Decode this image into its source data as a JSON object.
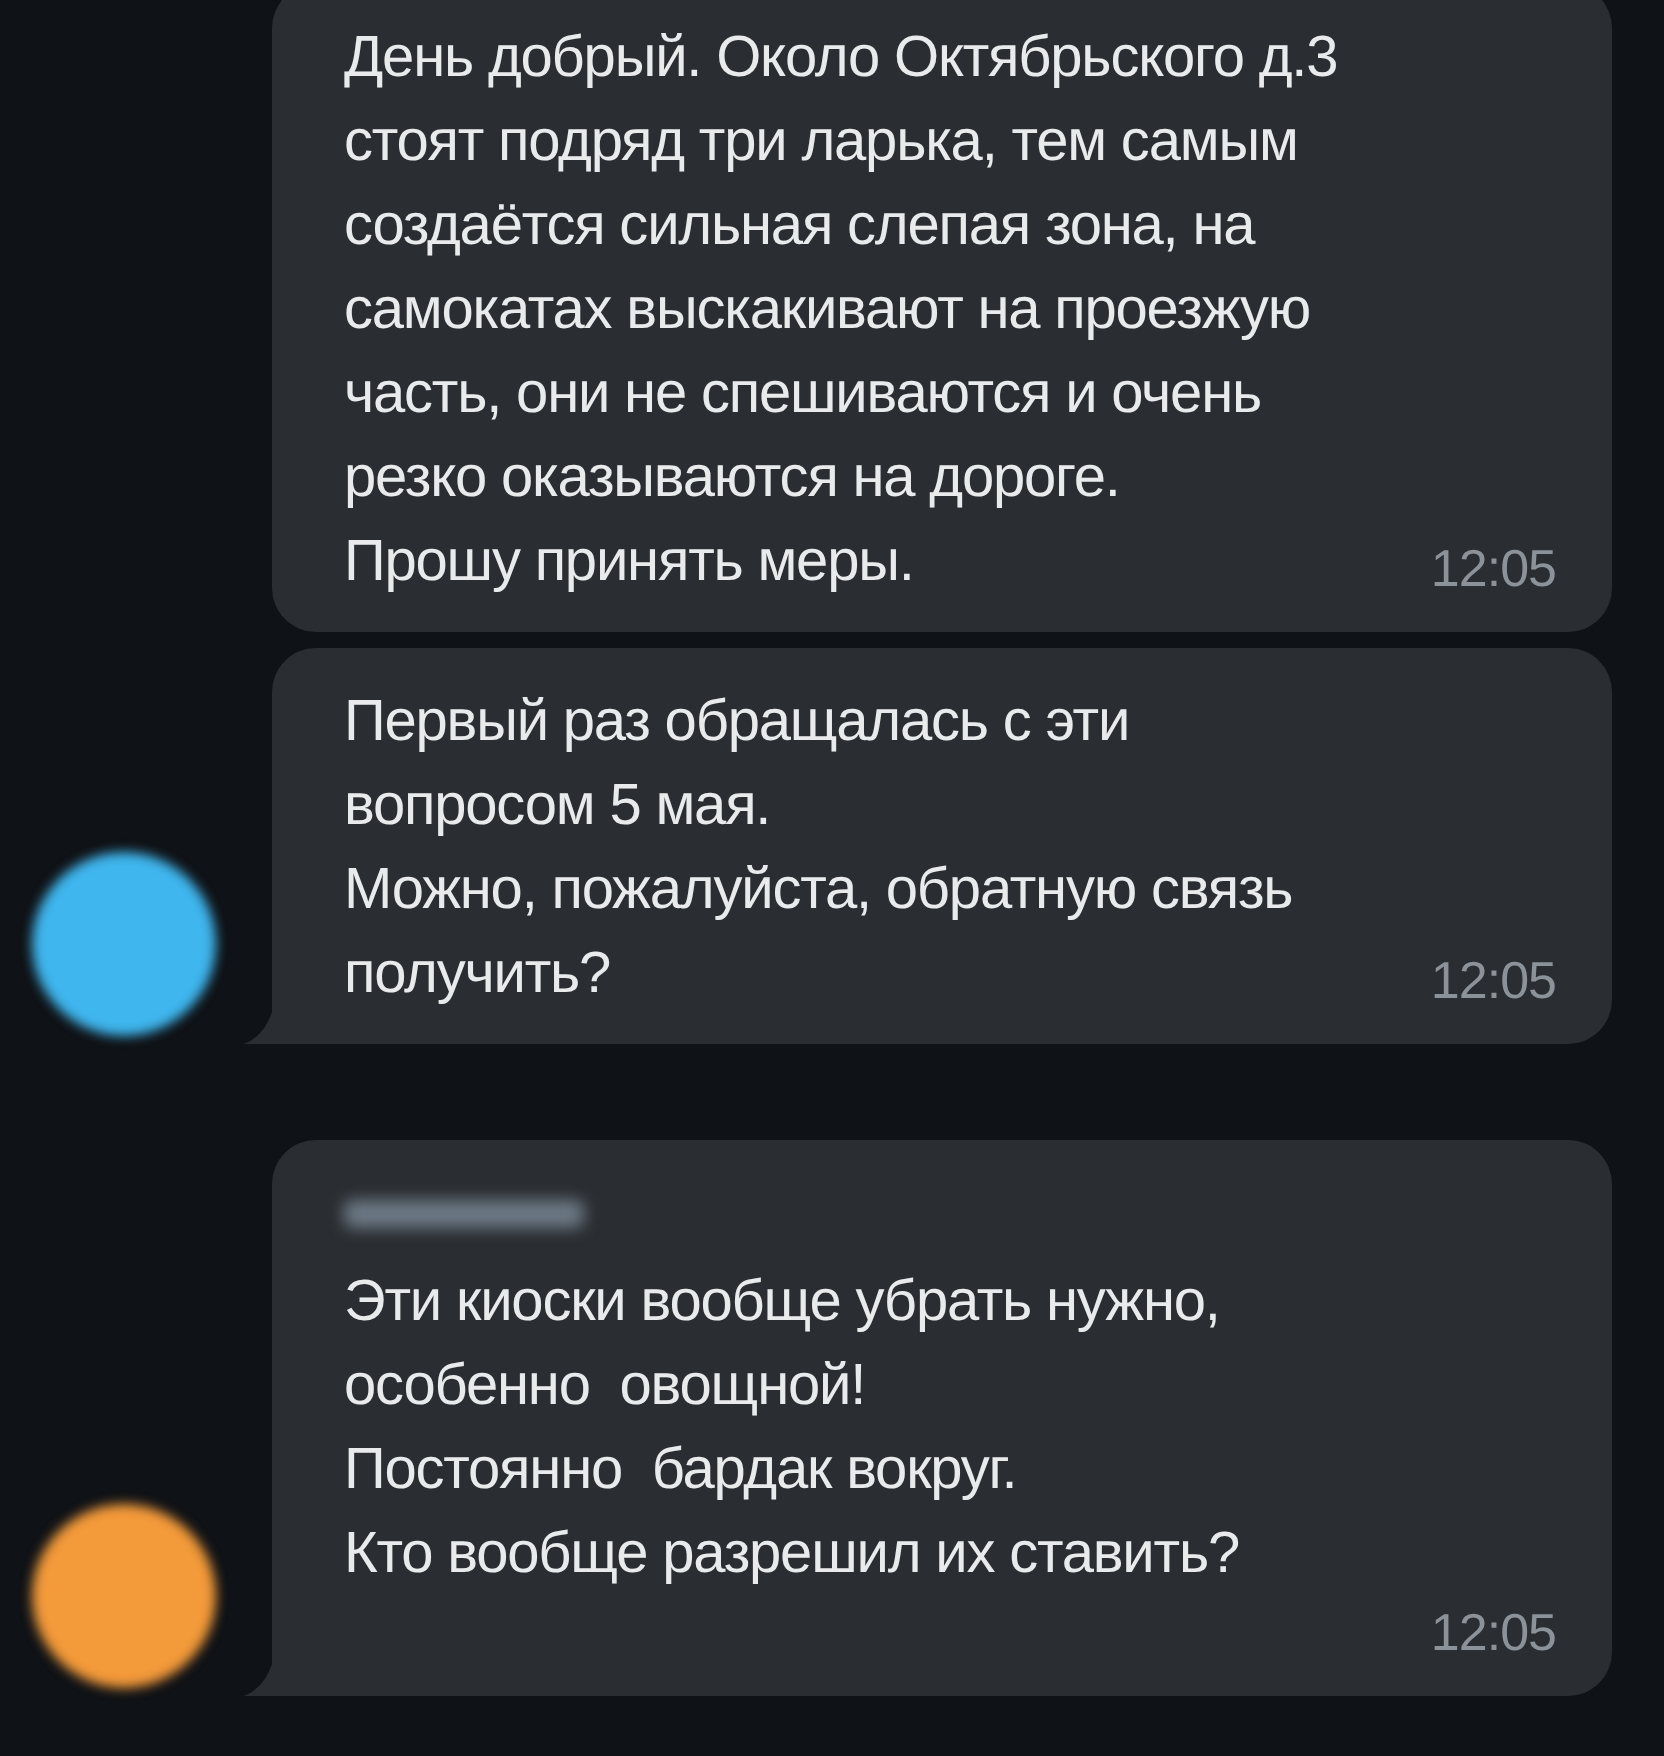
{
  "messages": [
    {
      "sender_hidden": false,
      "tail": false,
      "text": "День добрый. Около Октябрьского д.3\nстоят подряд три ларька, тем самым\nсоздаётся сильная слепая зона, на\nсамокатах выскакивают на проезжую\nчасть, они не спешиваются и очень\nрезко оказываются на дороге.\nПрошу принять меры.",
      "time": "12:05",
      "time_own_line": false
    },
    {
      "sender_hidden": false,
      "color": "#3fb6ee",
      "tail": true,
      "text": "Первый раз обращалась с эти\nвопросом 5 мая.\nМожно, пожалуйста, обратную связь\nполучить?",
      "time": "12:05",
      "time_own_line": false
    },
    {
      "sender_hidden": true,
      "color": "#f39a3a",
      "tail": true,
      "text": "Эти киоски вообще убрать нужно,\nособенно  овощной!\nПостоянно  бардак вокруг.\nКто вообще разрешил их ставить?",
      "time": "12:05",
      "time_own_line": true
    }
  ]
}
